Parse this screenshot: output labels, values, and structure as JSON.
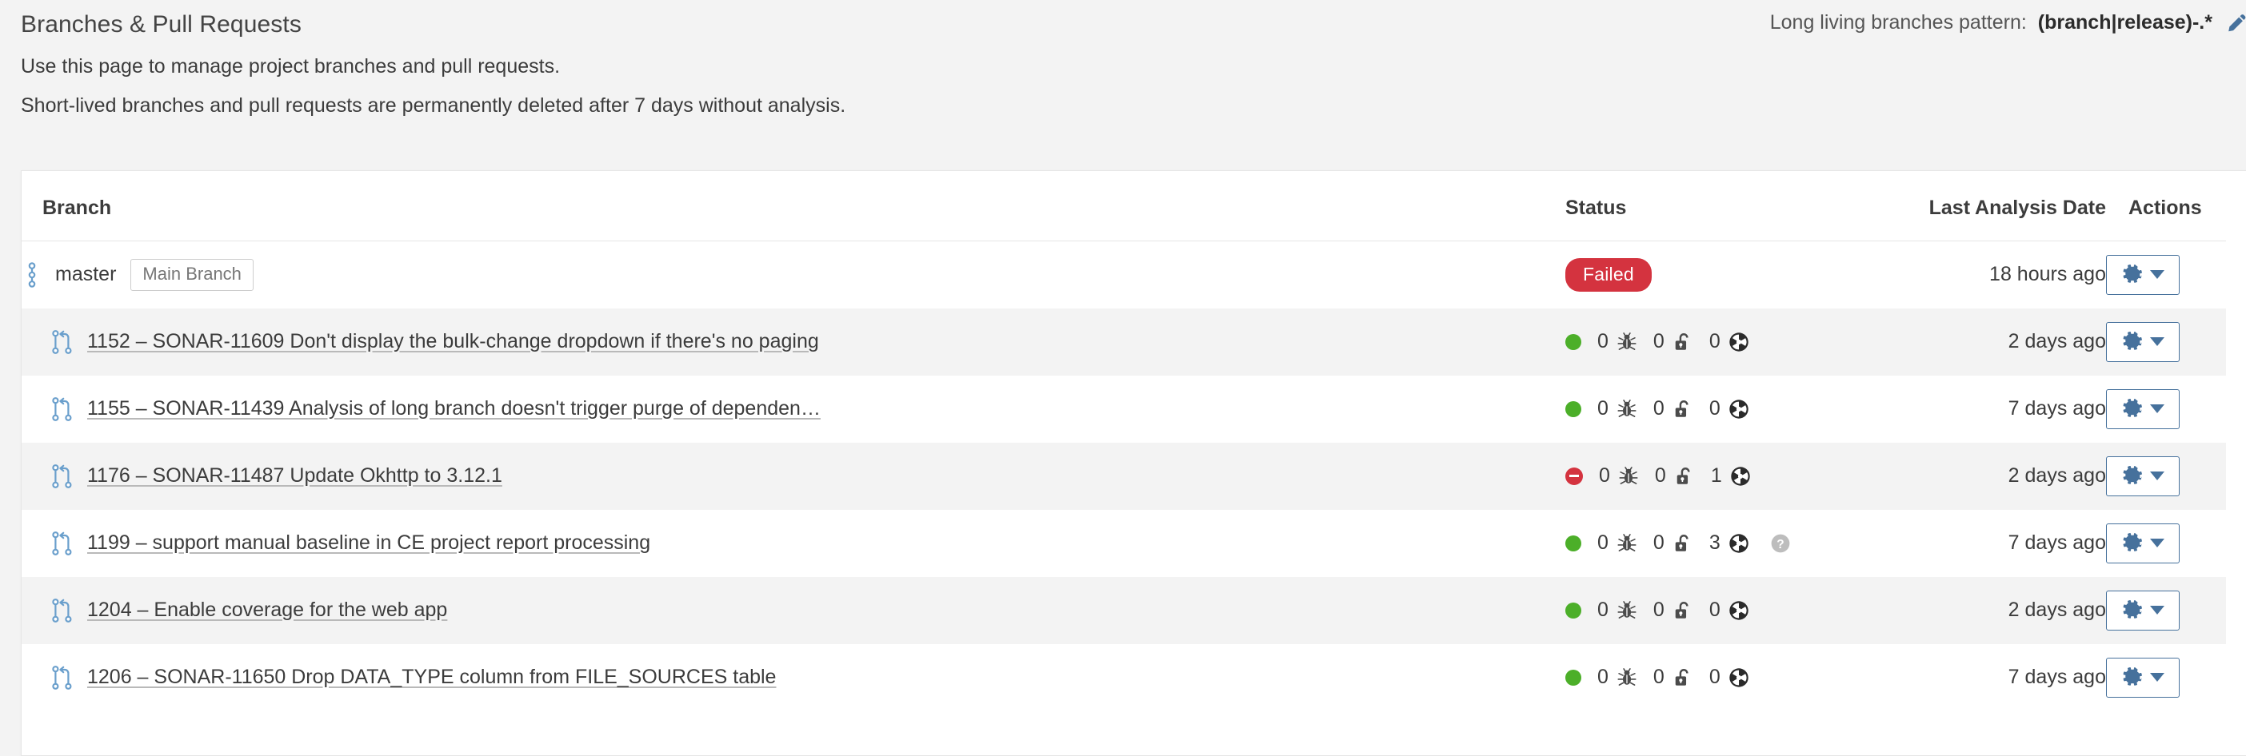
{
  "header": {
    "title": "Branches & Pull Requests",
    "description_1": "Use this page to manage project branches and pull requests.",
    "description_2": "Short-lived branches and pull requests are permanently deleted after 7 days without analysis.",
    "long_living_branches_label": "Long living branches pattern:",
    "long_living_branches_value": "(branch|release)-.*",
    "edit_icon": "pencil-edit-icon"
  },
  "table": {
    "columns": {
      "branch": "Branch",
      "status": "Status",
      "last_analysis_date": "Last Analysis Date",
      "actions": "Actions"
    },
    "rows": [
      {
        "type": "branch",
        "icon": "branch-icon",
        "name": "master",
        "badge": "Main Branch",
        "status_kind": "quality-gate",
        "quality_gate": "Failed",
        "last_analysis_date": "18 hours ago",
        "action_icon": "gear-icon"
      },
      {
        "type": "pull-request",
        "icon": "pull-request-icon",
        "name": "1152 – SONAR-11609 Don't display the bulk-change dropdown if there's no paging",
        "status_kind": "measures",
        "indicator": "ok",
        "bugs": "0",
        "vulnerabilities": "0",
        "code_smells": "0",
        "help": false,
        "last_analysis_date": "2 days ago",
        "action_icon": "gear-icon"
      },
      {
        "type": "pull-request",
        "icon": "pull-request-icon",
        "name": "1155 – SONAR-11439 Analysis of long branch doesn't trigger purge of dependen…",
        "status_kind": "measures",
        "indicator": "ok",
        "bugs": "0",
        "vulnerabilities": "0",
        "code_smells": "0",
        "help": false,
        "last_analysis_date": "7 days ago",
        "action_icon": "gear-icon"
      },
      {
        "type": "pull-request",
        "icon": "pull-request-icon",
        "name": "1176 – SONAR-11487 Update Okhttp to 3.12.1",
        "status_kind": "measures",
        "indicator": "error",
        "bugs": "0",
        "vulnerabilities": "0",
        "code_smells": "1",
        "help": false,
        "last_analysis_date": "2 days ago",
        "action_icon": "gear-icon"
      },
      {
        "type": "pull-request",
        "icon": "pull-request-icon",
        "name": "1199 – support manual baseline in CE project report processing",
        "status_kind": "measures",
        "indicator": "ok",
        "bugs": "0",
        "vulnerabilities": "0",
        "code_smells": "3",
        "help": true,
        "last_analysis_date": "7 days ago",
        "action_icon": "gear-icon"
      },
      {
        "type": "pull-request",
        "icon": "pull-request-icon",
        "name": "1204 – Enable coverage for the web app",
        "status_kind": "measures",
        "indicator": "ok",
        "bugs": "0",
        "vulnerabilities": "0",
        "code_smells": "0",
        "help": false,
        "last_analysis_date": "2 days ago",
        "action_icon": "gear-icon"
      },
      {
        "type": "pull-request",
        "icon": "pull-request-icon",
        "name": "1206 – SONAR-11650 Drop DATA_TYPE column from FILE_SOURCES table",
        "status_kind": "measures",
        "indicator": "ok",
        "bugs": "0",
        "vulnerabilities": "0",
        "code_smells": "0",
        "help": false,
        "last_analysis_date": "7 days ago",
        "action_icon": "gear-icon"
      }
    ]
  },
  "colors": {
    "failed_badge": "#d4333f",
    "ok_dot": "#4caf29",
    "error_dot": "#d4333f",
    "accent_blue": "#46719c",
    "branch_icon_blue": "#6a9fcc",
    "row_alt": "#f3f3f3",
    "page_bg": "#f3f3f3"
  }
}
